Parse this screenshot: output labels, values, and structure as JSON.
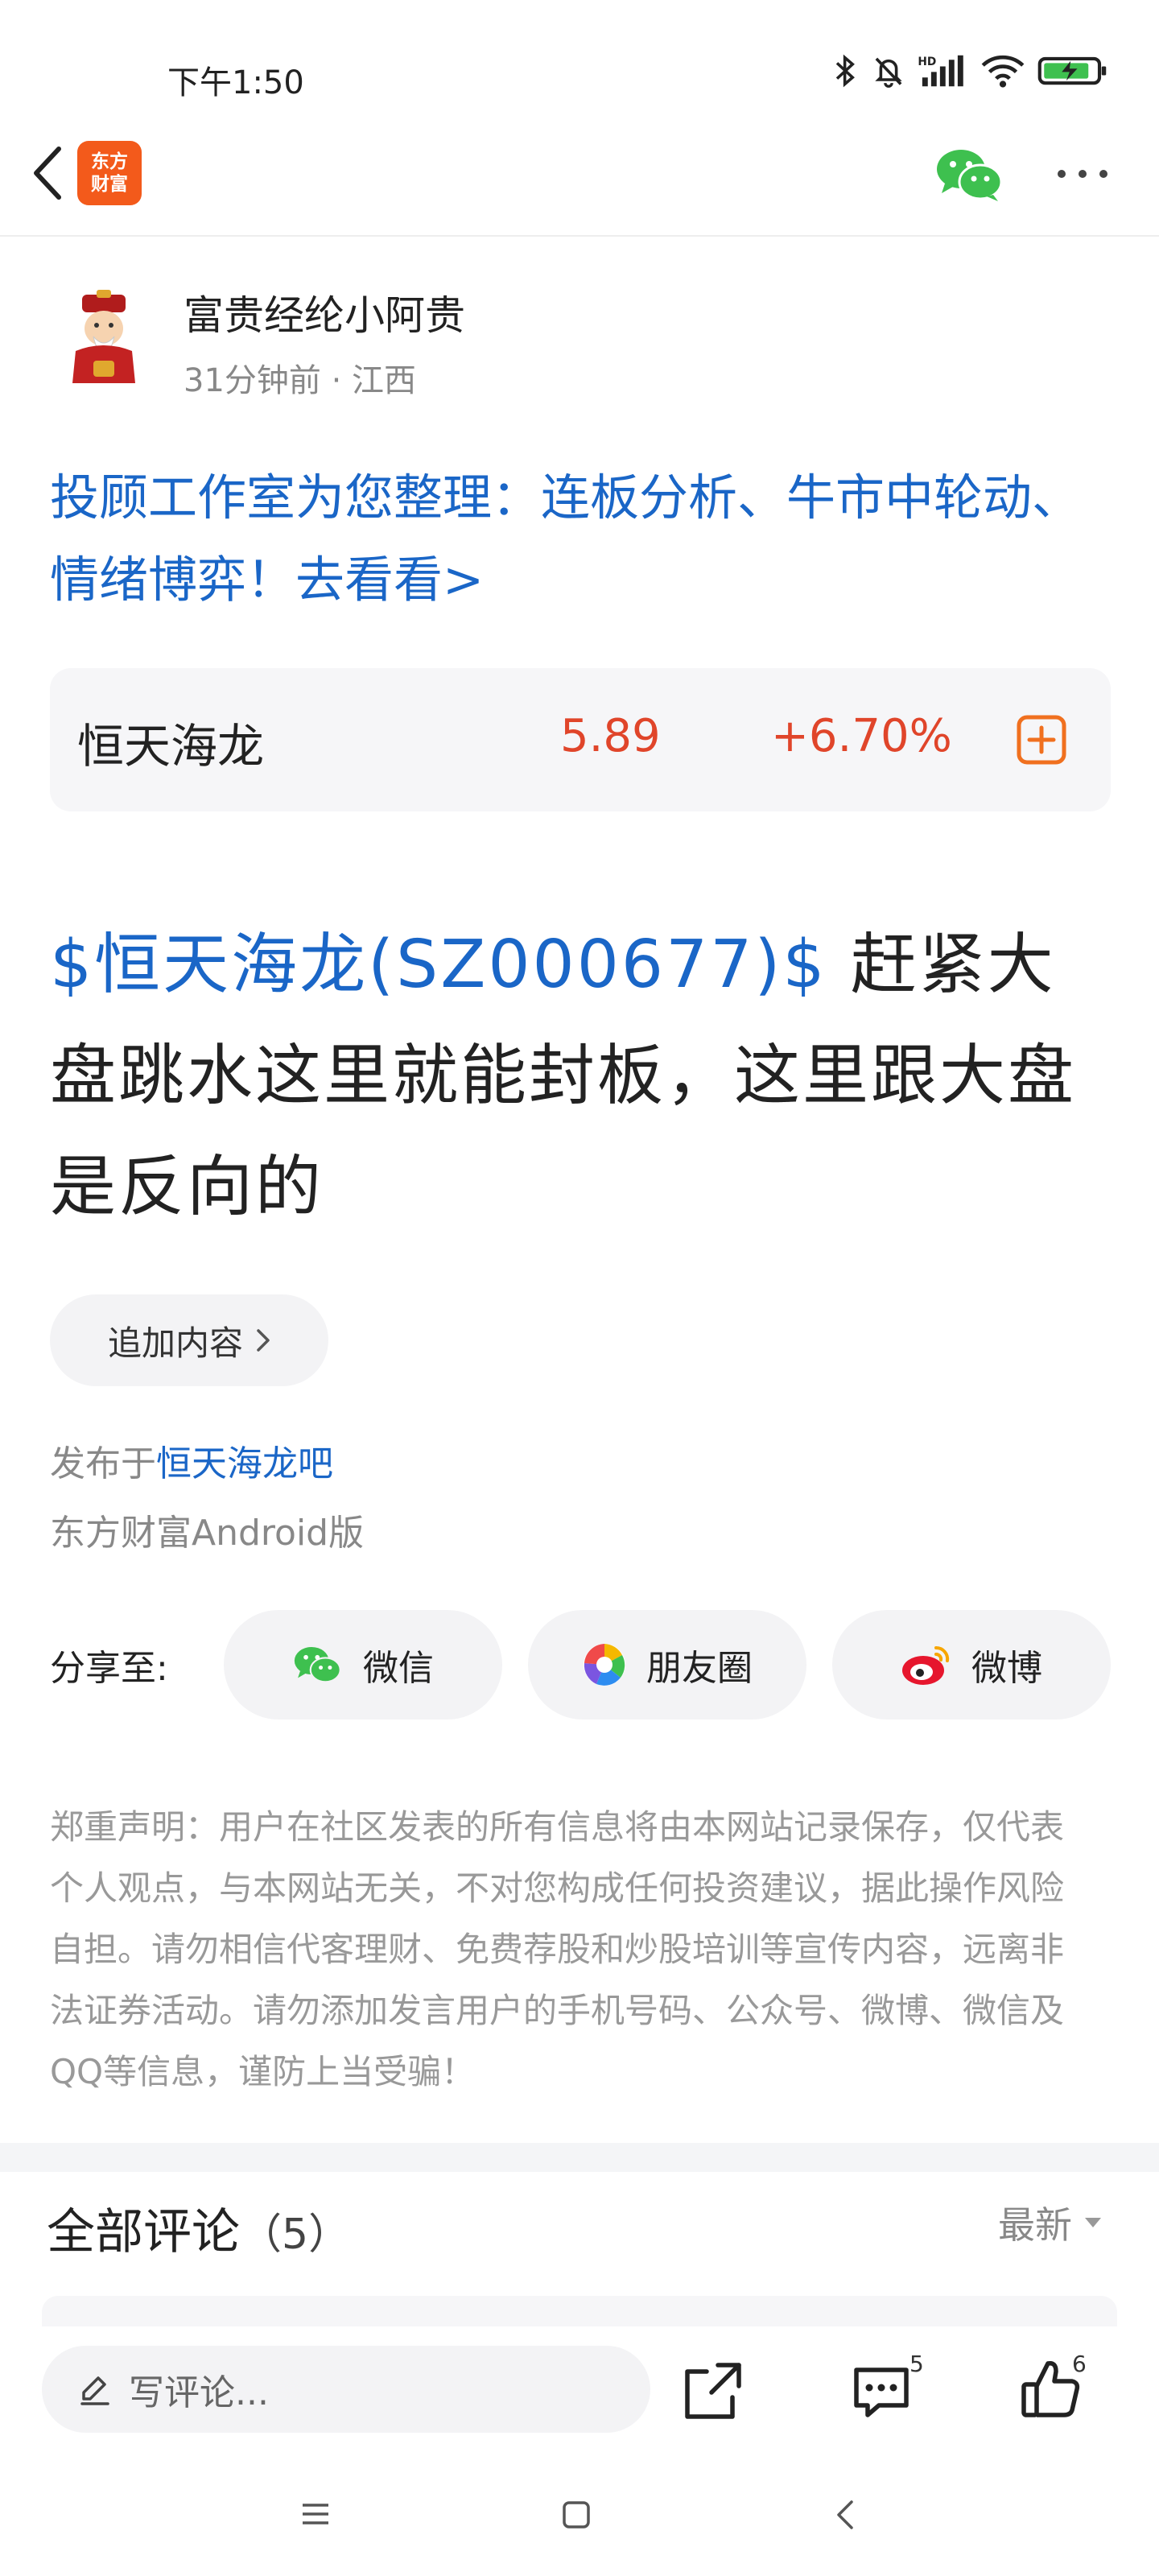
{
  "status_bar": {
    "time": "下午1:50",
    "icons": [
      "bluetooth-icon",
      "mute-icon",
      "hd-signal-icon",
      "wifi-icon",
      "battery-charging-icon"
    ]
  },
  "header": {
    "app_logo_line1": "东方",
    "app_logo_line2": "财富",
    "brand_color": "#f35a1b"
  },
  "author": {
    "name": "富贵经纶小阿贵",
    "meta": "31分钟前 · 江西"
  },
  "promo": {
    "text": "投顾工作室为您整理：连板分析、牛市中轮动、情绪博弈！去看看>"
  },
  "stock": {
    "name": "恒天海龙",
    "price": "5.89",
    "change": "+6.70%",
    "up_color": "#e0452a"
  },
  "post": {
    "stock_tag": "$恒天海龙(SZ000677)$",
    "body": "赶紧大盘跳水这里就能封板，这里跟大盘是反向的"
  },
  "add_content": {
    "label": "追加内容"
  },
  "publish": {
    "prefix": "发布于",
    "bar_name": "恒天海龙吧",
    "client": "东方财富Android版"
  },
  "share": {
    "label": "分享至:",
    "wechat": "微信",
    "moments": "朋友圈",
    "weibo": "微博"
  },
  "disclaimer": "郑重声明：用户在社区发表的所有信息将由本网站记录保存，仅代表个人观点，与本网站无关，不对您构成任何投资建议，据此操作风险自担。请勿相信代客理财、免费荐股和炒股培训等宣传内容，远离非法证券活动。请勿添加发言用户的手机号码、公众号、微博、微信及QQ等信息，谨防上当受骗！",
  "comments": {
    "title": "全部评论",
    "count": "（5）",
    "sort": "最新"
  },
  "bottom_bar": {
    "input_placeholder": "写评论...",
    "comment_count": "5",
    "like_count": "6"
  },
  "link_color": "#1a66c7"
}
